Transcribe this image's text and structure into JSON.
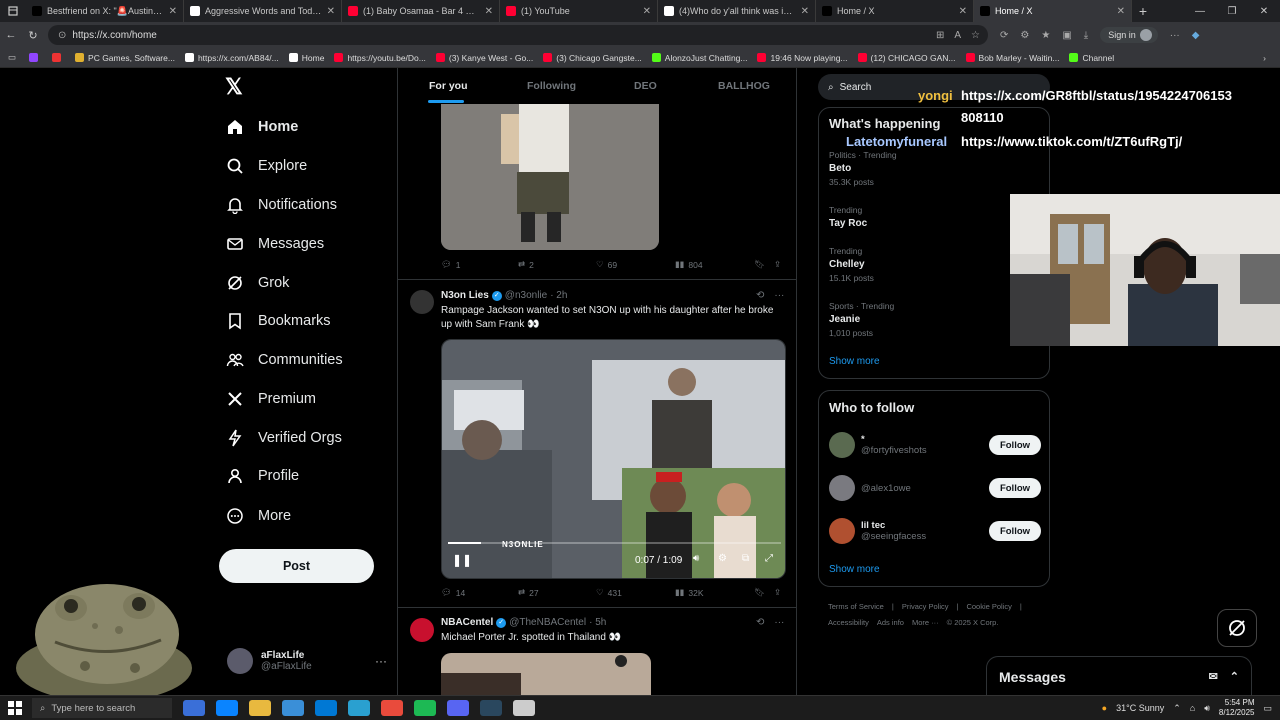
{
  "browser": {
    "tabs": [
      {
        "title": "Bestfriend on X: \"🚨Austin Police",
        "color": "#000000"
      },
      {
        "title": "Aggressive Words and Toddler F...",
        "color": "#ffffff"
      },
      {
        "title": "(1) Baby Osamaa - Bar 4 Bar | Fro",
        "color": "#ff0033"
      },
      {
        "title": "(1) YouTube",
        "color": "#ff0033"
      },
      {
        "title": "(4)Who do y'all think was in the...",
        "color": "#ffffff"
      },
      {
        "title": "Home / X",
        "color": "#000000"
      },
      {
        "title": "Home / X",
        "color": "#000000"
      }
    ],
    "url": "https://x.com/home",
    "sign_in": "Sign in",
    "bookmarks": [
      {
        "label": "",
        "color": "#9146ff"
      },
      {
        "label": "",
        "color": "#e33"
      },
      {
        "label": "PC Games, Software...",
        "color": "#e0b030"
      },
      {
        "label": "https://x.com/AB84/...",
        "color": "#ffffff"
      },
      {
        "label": "Home",
        "color": "#ffffff"
      },
      {
        "label": "https://youtu.be/Do...",
        "color": "#ff0033"
      },
      {
        "label": "(3) Kanye West - Go...",
        "color": "#ff0033"
      },
      {
        "label": "(3) Chicago Gangste...",
        "color": "#ff0033"
      },
      {
        "label": "AlonzoJust Chatting...",
        "color": "#53fc18"
      },
      {
        "label": "19:46 Now playing...",
        "color": "#ff0033"
      },
      {
        "label": "(12) CHICAGO GAN...",
        "color": "#ff0033"
      },
      {
        "label": "Bob Marley - Waitin...",
        "color": "#ff0033"
      },
      {
        "label": "Channel",
        "color": "#53fc18"
      }
    ]
  },
  "nav": {
    "items": [
      {
        "label": "Home",
        "icon": "home-icon"
      },
      {
        "label": "Explore",
        "icon": "search-icon"
      },
      {
        "label": "Notifications",
        "icon": "bell-icon"
      },
      {
        "label": "Messages",
        "icon": "mail-icon"
      },
      {
        "label": "Grok",
        "icon": "grok-icon"
      },
      {
        "label": "Bookmarks",
        "icon": "bookmark-icon"
      },
      {
        "label": "Communities",
        "icon": "people-icon"
      },
      {
        "label": "Premium",
        "icon": "x-icon"
      },
      {
        "label": "Verified Orgs",
        "icon": "bolt-icon"
      },
      {
        "label": "Profile",
        "icon": "person-icon"
      },
      {
        "label": "More",
        "icon": "more-icon"
      }
    ],
    "post_label": "Post",
    "account": {
      "name": "aFlaxLife",
      "handle": "@aFlaxLife"
    }
  },
  "feed": {
    "tabs": [
      "For you",
      "Following",
      "DEO",
      "BALLHOG"
    ],
    "tweet1": {
      "replies": "1",
      "retweets": "2",
      "likes": "69",
      "views": "804"
    },
    "tweet2": {
      "name": "N3on Lies",
      "handle": "@n3onlie",
      "time": "· 2h",
      "text": "Rampage Jackson wanted to set N3ON up with his daughter after he broke up with Sam Frank 👀",
      "video_time": "0:07 / 1:09",
      "video_progress": 0.1,
      "watermark": "N3ONLIE",
      "replies": "14",
      "retweets": "27",
      "likes": "431",
      "views": "32K"
    },
    "tweet3": {
      "name": "NBACentel",
      "handle": "@TheNBACentel",
      "time": "· 5h",
      "text": "Michael Porter Jr. spotted in Thailand 👀"
    }
  },
  "right": {
    "search_placeholder": "Search",
    "happening_title": "What's happening",
    "trends": [
      {
        "category": "Politics · Trending",
        "name": "Beto",
        "count": "35.3K posts"
      },
      {
        "category": "Trending",
        "name": "Tay Roc",
        "count": ""
      },
      {
        "category": "Trending",
        "name": "Chelley",
        "count": "15.1K posts"
      },
      {
        "category": "Sports · Trending",
        "name": "Jeanie",
        "count": "1,010 posts"
      }
    ],
    "show_more": "Show more",
    "who_to_follow_title": "Who to follow",
    "follow": [
      {
        "name": "*",
        "handle": "@fortyfiveshots",
        "button": "Follow"
      },
      {
        "name": "",
        "handle": "@alex1owe",
        "button": "Follow"
      },
      {
        "name": "lil tec",
        "handle": "@seeingfacess",
        "button": "Follow"
      }
    ],
    "show_more_2": "Show more",
    "footer_line1": [
      "Terms of Service",
      "|",
      "Privacy Policy",
      "|",
      "Cookie Policy",
      "|"
    ],
    "footer_line2": [
      "Accessibility",
      "Ads info",
      "More ···",
      "© 2025 X Corp."
    ],
    "messages_label": "Messages"
  },
  "overlay": {
    "name1": "yongi",
    "link1a": "https://x.com/GR8ftbl/status/1954224706153",
    "link1b": "808110",
    "name2": "Latetomyfuneral",
    "link2": "https://www.tiktok.com/t/ZT6ufRgTj/"
  },
  "taskbar": {
    "search_placeholder": "Type here to search",
    "weather": "31°C  Sunny",
    "time": "5:54 PM",
    "date": "8/12/2025",
    "app_colors": [
      "#3a6fd8",
      "#0a84ff",
      "#e8b93f",
      "#3a8fd8",
      "#0078d4",
      "#2aa0d0",
      "#e94b3c",
      "#1db954",
      "#5865f2",
      "#2a475e",
      "#cccccc"
    ]
  }
}
